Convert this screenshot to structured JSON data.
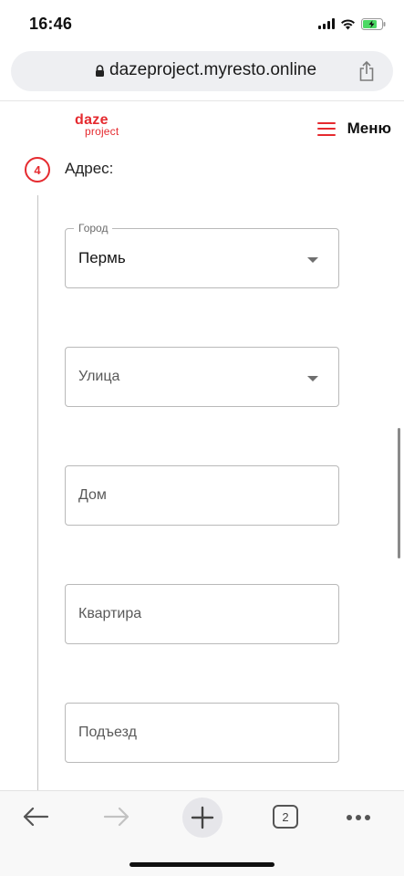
{
  "status_bar": {
    "time": "16:46",
    "icons": [
      "signal-icon",
      "wifi-icon",
      "battery-charging-icon"
    ]
  },
  "browser": {
    "url": "dazeproject.myresto.online",
    "icons": [
      "lock-icon",
      "share-icon"
    ],
    "tab_count": "2",
    "toolbar_icons": [
      "back-arrow-icon",
      "forward-arrow-icon",
      "new-tab-plus-icon",
      "tabs-icon",
      "more-icon"
    ]
  },
  "site_header": {
    "logo_main": "daze",
    "logo_sub": "project",
    "menu_label": "Меню",
    "accent_color": "#e52a2f"
  },
  "step": {
    "number": "4",
    "title": "Адрес:"
  },
  "form": {
    "city": {
      "label": "Город",
      "value": "Пермь"
    },
    "street": {
      "placeholder": "Улица"
    },
    "house": {
      "placeholder": "Дом"
    },
    "apartment": {
      "placeholder": "Квартира"
    },
    "entrance": {
      "placeholder": "Подъезд"
    }
  }
}
